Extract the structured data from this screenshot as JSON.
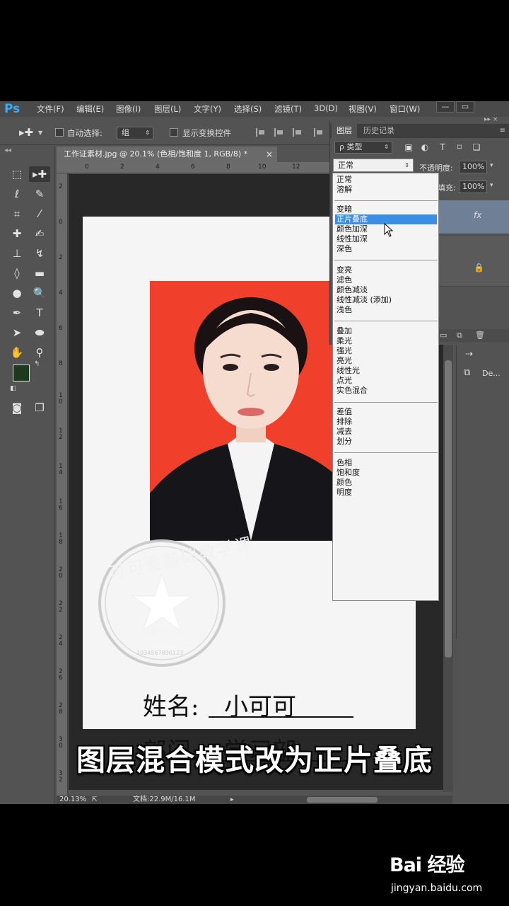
{
  "menubar": {
    "logo": "Ps",
    "items": [
      "文件(F)",
      "编辑(E)",
      "图像(I)",
      "图层(L)",
      "文字(Y)",
      "选择(S)",
      "滤镜(T)",
      "3D(D)",
      "视图(V)",
      "窗口(W)"
    ],
    "window_buttons": [
      "—",
      "▭"
    ]
  },
  "options": {
    "auto_select_label": "自动选择:",
    "auto_select_value": "组",
    "show_transform_label": "显示变换控件"
  },
  "document": {
    "tab_title": "工作证素材.jpg @ 20.1% (色相/饱和度 1, RGB/8) *",
    "ruler_top": [
      "0",
      "2",
      "4",
      "6",
      "8",
      "10",
      "12"
    ],
    "ruler_left": [
      "2",
      "0",
      "2",
      "4",
      "6",
      "8",
      "1\n0",
      "1\n2",
      "1\n4",
      "1\n6",
      "1\n8",
      "2\n0",
      "2\n2",
      "2\n4",
      "2\n6",
      "2\n8",
      "3\n0",
      "3\n2"
    ],
    "card": {
      "name_label": "姓名:",
      "name_value": "小可可",
      "dept_label": "部门:",
      "dept_value": "学习部"
    },
    "stamp": {
      "arc_text": "可可爱基础教学课",
      "center_text": "注册专用章",
      "bottom_digits": "1034567890123"
    }
  },
  "statusbar": {
    "zoom": "20.13%",
    "doc_info": "文档:22.9M/16.1M"
  },
  "layers_panel": {
    "tabs": [
      "图层",
      "历史记录"
    ],
    "filter_label": "ρ 类型",
    "blend_mode_value": "正常",
    "opacity_label": "不透明度:",
    "opacity_value": "100%",
    "fill_label": "填充:",
    "fill_value": "100%",
    "fx_label": "fx",
    "blend_groups": [
      [
        "正常",
        "溶解"
      ],
      [
        "变暗",
        "正片叠底",
        "颜色加深",
        "线性加深",
        "深色"
      ],
      [
        "变亮",
        "滤色",
        "颜色减淡",
        "线性减淡 (添加)",
        "浅色"
      ],
      [
        "叠加",
        "柔光",
        "强光",
        "亮光",
        "线性光",
        "点光",
        "实色混合"
      ],
      [
        "差值",
        "排除",
        "减去",
        "划分"
      ],
      [
        "色相",
        "饱和度",
        "颜色",
        "明度"
      ]
    ],
    "selected_mode": "正片叠底"
  },
  "side_mini": {
    "item_label": "De..."
  },
  "caption": "图层混合模式改为正片叠底",
  "watermark": {
    "logo": "Bai 经验",
    "url": "jingyan.baidu.com"
  },
  "colors": {
    "photo_bg": "#f0402c",
    "ps_blue": "#3fa9f5",
    "selection": "#3a8ee6",
    "foreground": "#1e3a1e"
  }
}
